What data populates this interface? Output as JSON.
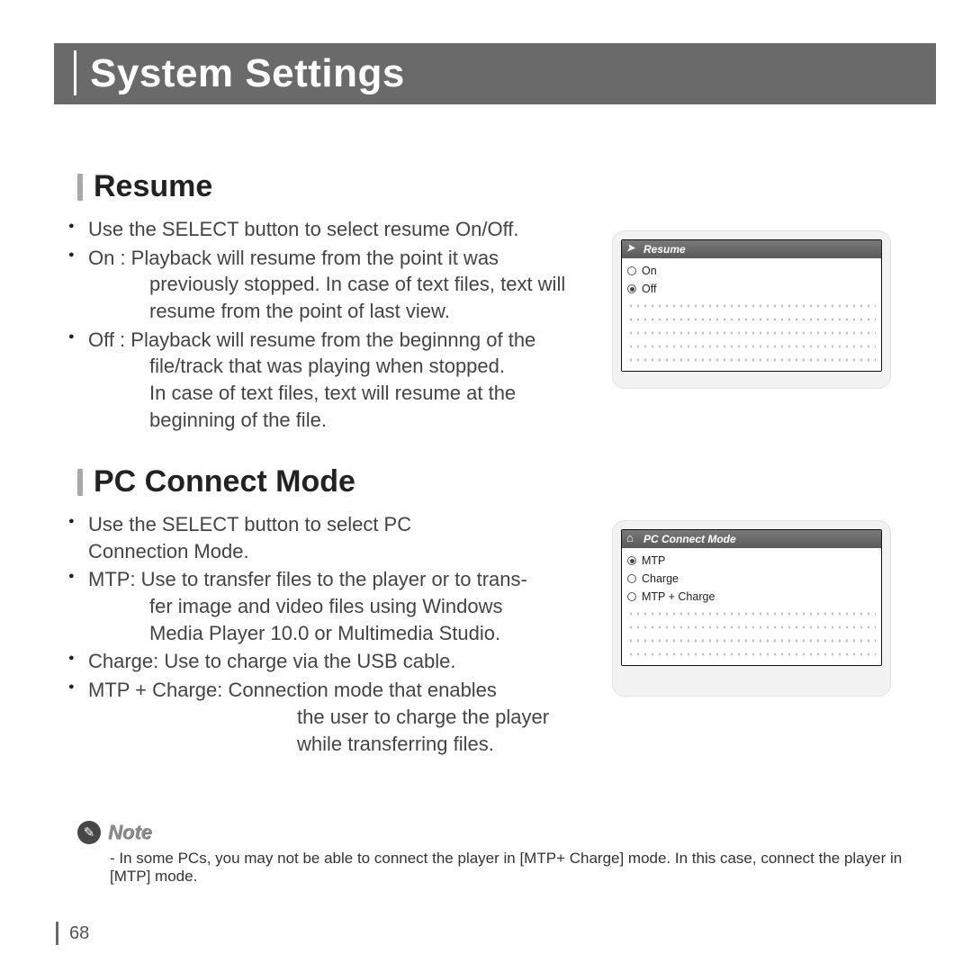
{
  "banner": {
    "title": "System Settings"
  },
  "page_number": "68",
  "resume": {
    "heading": "Resume",
    "bullets": {
      "b1": "Use the SELECT button to select resume On/Off.",
      "b2a": "On : Playback will resume from the point it was",
      "b2b": "previously stopped. In case of text files, text will",
      "b2c": "resume from the point of last view.",
      "b3a": "Off : Playback will resume from the beginnng of the",
      "b3b": "file/track that was playing when stopped.",
      "b3c": "In case of text files, text will resume at the",
      "b3d": "beginning of the file."
    },
    "card": {
      "title": "Resume",
      "options": [
        {
          "label": "On",
          "selected": false
        },
        {
          "label": "Off",
          "selected": true
        }
      ]
    }
  },
  "pcmode": {
    "heading": "PC Connect Mode",
    "bullets": {
      "b1a": "Use the SELECT button to select PC",
      "b1b": "Connection Mode.",
      "b2a": "MTP: Use to transfer files to the player or to trans-",
      "b2b": "fer image and video files using Windows",
      "b2c": "Media Player 10.0 or Multimedia Studio.",
      "b3": "Charge: Use to charge via the USB cable.",
      "b4a": "MTP + Charge: Connection mode that enables",
      "b4b": "the user to charge the player",
      "b4c": "while transferring files."
    },
    "card": {
      "title": "PC Connect Mode",
      "options": [
        {
          "label": "MTP",
          "selected": true
        },
        {
          "label": "Charge",
          "selected": false
        },
        {
          "label": "MTP + Charge",
          "selected": false
        }
      ]
    }
  },
  "note": {
    "label": "Note",
    "text": "- In some PCs, you may not be able to connect the player in [MTP+ Charge] mode. In this case, connect the player in [MTP] mode."
  }
}
